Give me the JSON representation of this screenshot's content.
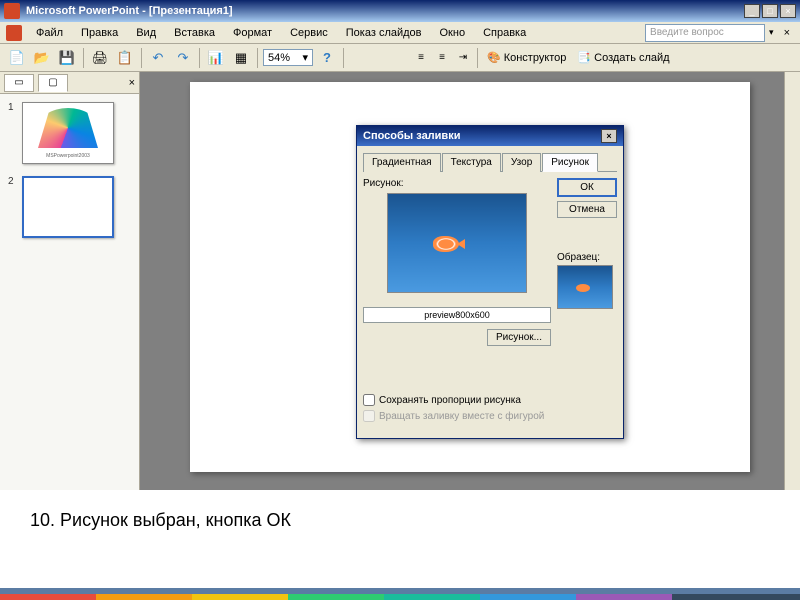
{
  "titlebar": {
    "title": "Microsoft PowerPoint - [Презентация1]"
  },
  "menu": {
    "file": "Файл",
    "edit": "Правка",
    "view": "Вид",
    "insert": "Вставка",
    "format": "Формат",
    "service": "Сервис",
    "slideshow": "Показ слайдов",
    "window": "Окно",
    "help": "Справка",
    "helpbox": "Введите вопрос"
  },
  "toolbar": {
    "zoom": "54%",
    "constructor": "Конструктор",
    "newslide": "Создать слайд"
  },
  "thumbs": {
    "slide1_num": "1",
    "slide1_caption": "MSPowerpoint2003",
    "slide2_num": "2"
  },
  "dialog": {
    "title": "Способы заливки",
    "tabs": {
      "gradient": "Градиентная",
      "texture": "Текстура",
      "pattern": "Узор",
      "picture": "Рисунок"
    },
    "picture_label": "Рисунок:",
    "preview_text": "preview800x600",
    "pick_button": "Рисунок...",
    "ok": "ОК",
    "cancel": "Отмена",
    "sample": "Образец:",
    "keep_ratio": "Сохранять пропорции рисунка",
    "rotate_fill": "Вращать заливку вместе с фигурой"
  },
  "caption": "10.   Рисунок выбран, кнопка ОК"
}
